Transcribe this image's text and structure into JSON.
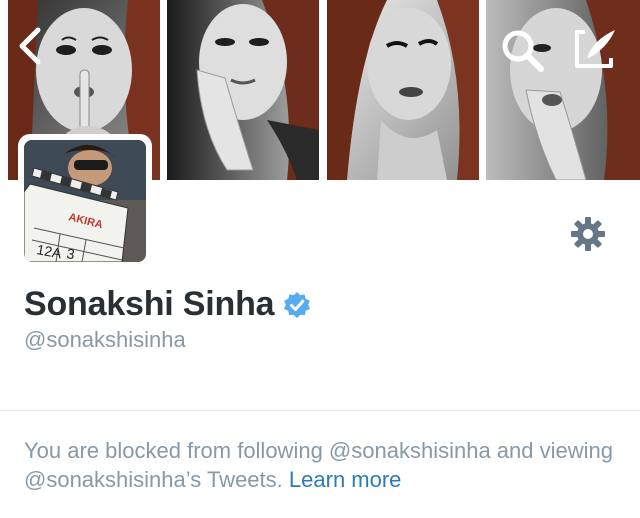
{
  "header": {
    "photos": [
      "header-photo-1",
      "header-photo-2",
      "header-photo-3",
      "header-photo-4"
    ],
    "icons": {
      "back": "chevron-left-icon",
      "search": "search-icon",
      "compose": "compose-icon"
    }
  },
  "profile": {
    "name": "Sonakshi Sinha",
    "handle": "@sonakshisinha",
    "verified": true,
    "avatar_clapboard_text": "AKIRA"
  },
  "settings": {
    "icon": "gear-icon"
  },
  "blocked": {
    "message": "You are blocked from following @sonakshisinha and viewing @sonakshisinha’s Tweets.",
    "link": "Learn more"
  },
  "colors": {
    "name": "#292f33",
    "muted": "#8899a6",
    "link": "#2b7bb9",
    "verified": "#55acee",
    "gear": "#657786",
    "divider": "#e1e8ed"
  }
}
